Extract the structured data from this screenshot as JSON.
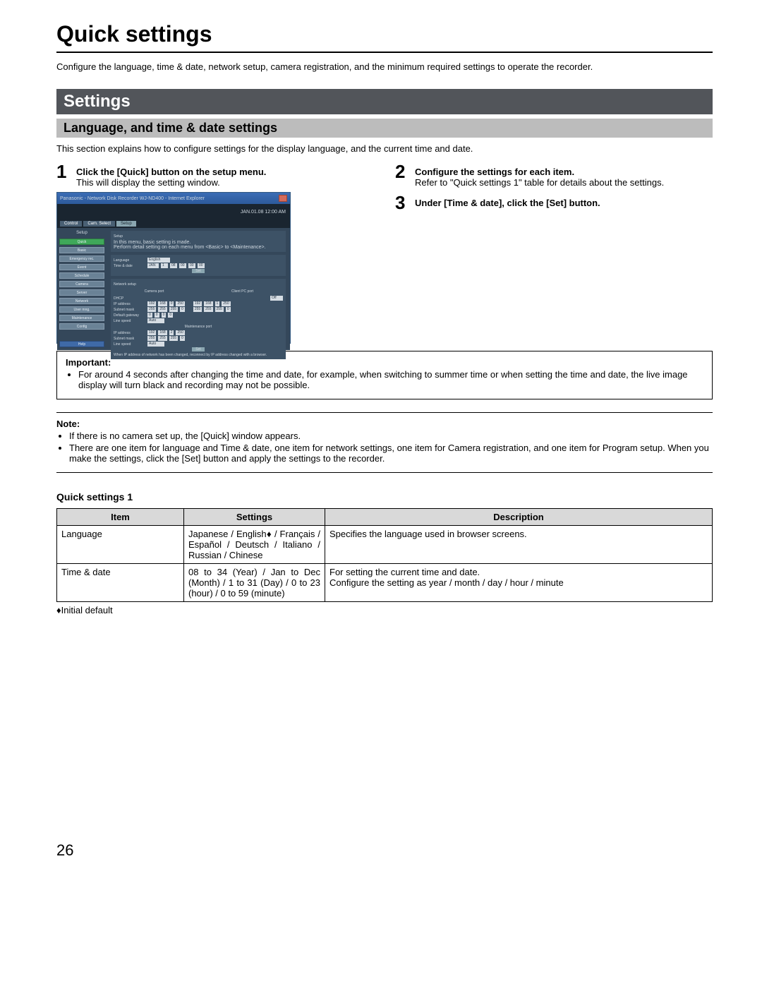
{
  "page": {
    "title": "Quick settings",
    "intro": "Configure the language, time & date, network setup, camera registration, and the minimum required settings to operate the recorder.",
    "number": "26"
  },
  "settings_bar": "Settings",
  "subsection": "Language, and time & date settings",
  "section_intro": "This section explains how to configure settings for the display language, and the current time and date.",
  "steps": {
    "s1": {
      "num": "1",
      "title": "Click the [Quick] button on the setup menu.",
      "text": "This will display the setting window."
    },
    "s2": {
      "num": "2",
      "title": "Configure the settings for each item.",
      "text": "Refer to \"Quick settings 1\" table for details about the settings."
    },
    "s3": {
      "num": "3",
      "title": "Under [Time & date], click the [Set] button.",
      "text": ""
    }
  },
  "screenshot": {
    "window_title": "Panasonic - Network Disk Recorder WJ-ND400 - Internet Explorer",
    "date": "JAN.01.08  12:00  AM",
    "tabs": {
      "control": "Control",
      "cam_select": "Cam. Select",
      "setup": "Setup"
    },
    "sidebar": {
      "heading": "Setup",
      "items": [
        "Quick",
        "Basic",
        "Emergency rec.",
        "Event",
        "Schedule",
        "Camera",
        "Server",
        "Network",
        "User mng.",
        "Maintenance",
        "Config"
      ],
      "help": "Help"
    },
    "main": {
      "heading": "Setup",
      "notice1": "In this menu, basic setting is made.",
      "notice2": "Perform detail setting on each menu from <Basic> to <Maintenance>.",
      "language_label": "Language",
      "language_value": "English",
      "timedate_label": "Time & date",
      "timedate_values": [
        "JAN",
        "1",
        "08",
        "00",
        "00",
        "00"
      ],
      "set": "Set",
      "network_label": "Network setup",
      "cam_port": "Camera port",
      "client_port": "Client PC port",
      "dhcp": "DHCP",
      "dhcp_val": "Off",
      "ip": "IP address",
      "ip_vals": [
        "192",
        "168",
        "0",
        "250",
        "192",
        "168",
        "1",
        "250"
      ],
      "subnet": "Subnet mask",
      "subnet_vals": [
        "255",
        "255",
        "255",
        "0",
        "255",
        "255",
        "255",
        "0"
      ],
      "gateway": "Default gateway",
      "gateway_vals": [
        "0",
        "0",
        "0",
        "0"
      ],
      "line": "Line speed",
      "line_val": "Auto",
      "maint": "Maintenance port",
      "maint_ip_vals": [
        "192",
        "168",
        "2",
        "250"
      ],
      "maint_sub_vals": [
        "255",
        "255",
        "255",
        "0"
      ],
      "bottom_note": "When IP address of network has been changed, reconnect by IP address changed with a browser."
    }
  },
  "important": {
    "label": "Important:",
    "items": [
      "For around 4 seconds after changing the time and date, for example, when switching to summer time or when setting the time and date, the live image display will turn black and recording may not be possible."
    ]
  },
  "note": {
    "label": "Note:",
    "items": [
      "If there is no camera set up, the [Quick] window appears.",
      "There are one item for language and Time & date, one item for network settings, one item for Camera registration, and one item for Program setup. When you make the settings, click the [Set] button and apply the settings to the recorder."
    ]
  },
  "table": {
    "caption": "Quick settings 1",
    "headers": {
      "item": "Item",
      "settings": "Settings",
      "description": "Description"
    },
    "rows": [
      {
        "item": "Language",
        "settings": "Japanese / English♦ / Français / Español / Deutsch / Italiano / Russian / Chinese",
        "description": "Specifies the language used in browser screens."
      },
      {
        "item": "Time & date",
        "settings": "08 to 34 (Year) / Jan to Dec (Month) / 1 to 31 (Day) / 0 to 23 (hour) / 0 to 59 (minute)",
        "description": "For setting the current time and date.\nConfigure the setting as year / month / day / hour / minute"
      }
    ],
    "footnote": "♦Initial default"
  }
}
